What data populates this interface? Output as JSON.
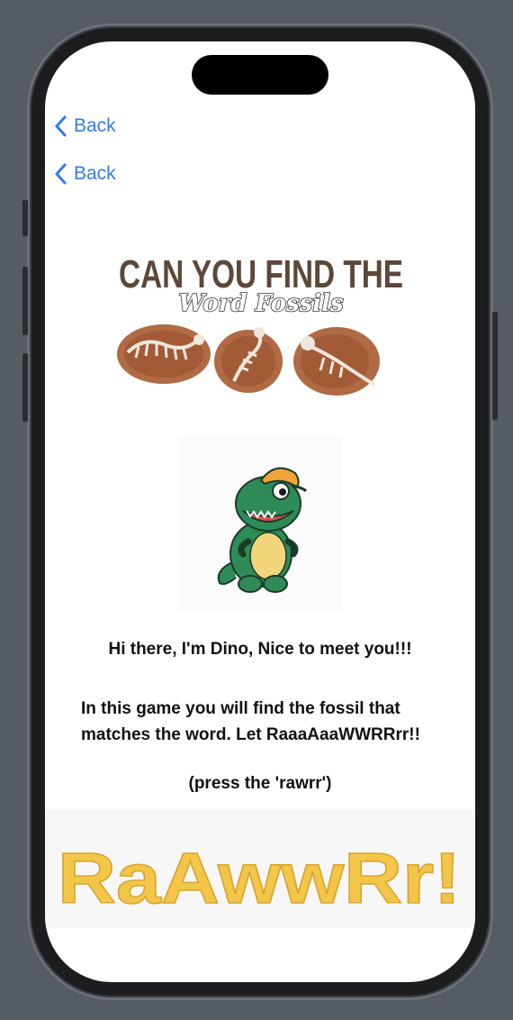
{
  "nav": {
    "back_label_1": "Back",
    "back_label_2": "Back"
  },
  "title_graphic": {
    "line1": "CAN YOU FIND THE",
    "line2": "Word Fossils",
    "icon": "dinosaur-fossil-icons"
  },
  "mascot": {
    "name": "Dino",
    "icon": "cartoon-dinosaur-icon"
  },
  "content": {
    "greeting": "Hi there, I'm Dino, Nice to meet you!!!",
    "intro": "In this game you will find the fossil that matches the word. Let RaaaAaaWWRRrr!!",
    "press_hint": "(press the 'rawrr')"
  },
  "rawr_button": {
    "label": "RaAwwRr!"
  },
  "colors": {
    "link": "#2f7bf0",
    "title_brown": "#5e4738",
    "fossil_mud": "#b06a44",
    "rawr_yellow": "#f3c64a",
    "dino_green": "#2e8b57"
  }
}
